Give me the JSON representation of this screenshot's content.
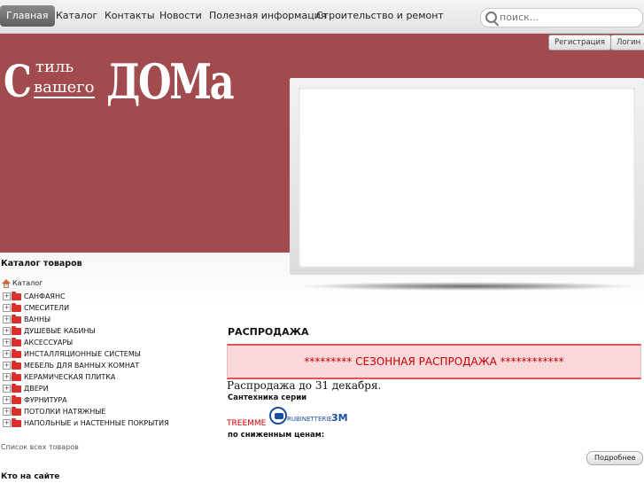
{
  "nav": {
    "items": [
      {
        "label": "Главная",
        "active": true
      },
      {
        "label": "Каталог",
        "active": false
      },
      {
        "label": "Контакты",
        "active": false
      },
      {
        "label": "Новости",
        "active": false
      },
      {
        "label": "Полезная информация",
        "active": false
      },
      {
        "label": "Строительство и ремонт",
        "active": false
      }
    ],
    "search_placeholder": "поиск..."
  },
  "auth": {
    "register": "Регистрация",
    "login": "Логин"
  },
  "logo": {
    "line1_big": "С",
    "line1_small_top": "тиль",
    "line1_small_bottom": "вашего",
    "line2_big": "ДОМа"
  },
  "sidebar": {
    "title": "Каталог товаров",
    "root": "Каталог",
    "items": [
      "САНФАЯНС",
      "СМЕСИТЕЛИ",
      "ВАННЫ",
      "ДУШЕВЫЕ КАБИНЫ",
      "АКСЕССУАРЫ",
      "ИНСТАЛЛЯЦИОННЫЕ СИСТЕМЫ",
      "МЕБЕЛЬ ДЛЯ ВАННЫХ КОМНАТ",
      "КЕРАМИЧЕСКАЯ ПЛИТКА",
      "ДВЕРИ",
      "ФУРНИТУРА",
      "ПОТОЛКИ НАТЯЖНЫЕ",
      "НАПОЛЬНЫЕ и НАСТЕННЫЕ ПОКРЫТИЯ"
    ],
    "all_goods": "Список всех товаров",
    "who_online": "Кто на сайте"
  },
  "main": {
    "title": "РАСПРОДАЖА",
    "banner": "********* СЕЗОННАЯ РАСПРОДАЖА ************",
    "until": "Распродажа до 31 декабря.",
    "series": "Сантехника серии",
    "treemme": "TREEMME",
    "rubi_brand": "RUBINETTERIE",
    "rubi_3m": "3M",
    "lower_price": "по сниженным ценам:",
    "more": "Подробнее"
  },
  "colors": {
    "header": "#a14b4e",
    "banner_bg": "#f8d8da",
    "banner_text": "#cc0000",
    "folder": "#d8302c"
  }
}
